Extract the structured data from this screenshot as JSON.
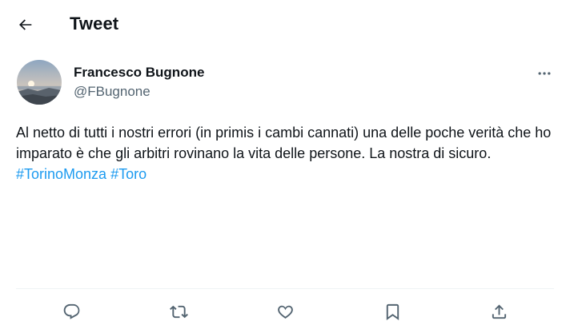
{
  "header": {
    "back_icon": "arrow-left-icon",
    "title": "Tweet"
  },
  "tweet": {
    "author": {
      "name": "Francesco Bugnone",
      "handle": "@FBugnone"
    },
    "more_icon": "more-horizontal-icon",
    "text_parts": {
      "body": "Al netto di tutti i nostri errori (in primis i cambi cannati) una delle poche verità che ho imparato è che gli arbitri rovinano la vita delle persone. La nostra di sicuro.",
      "hashtag_1": "#TorinoMonza",
      "hashtag_2": "#Toro"
    },
    "actions": [
      "reply-icon",
      "retweet-icon",
      "like-icon",
      "bookmark-icon",
      "share-icon"
    ]
  },
  "colors": {
    "text": "#0f1419",
    "secondary": "#536471",
    "accent": "#1d9bf0",
    "divider": "#eff3f4"
  }
}
